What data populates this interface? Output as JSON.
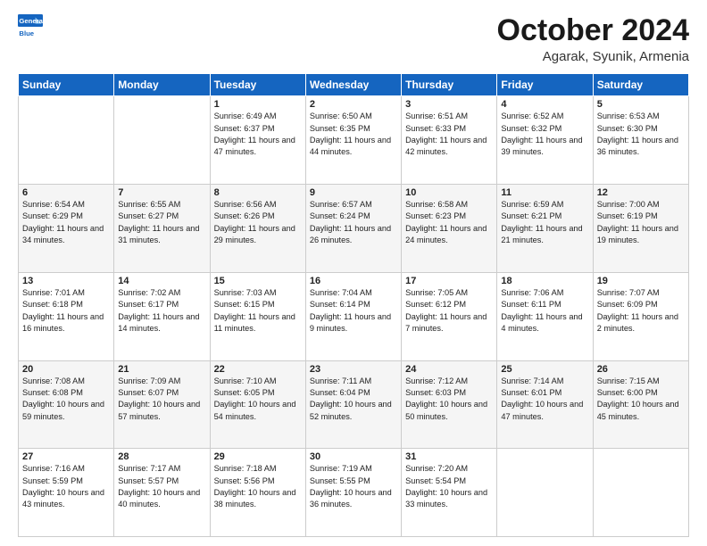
{
  "header": {
    "logo_line1": "General",
    "logo_line2": "Blue",
    "title": "October 2024",
    "subtitle": "Agarak, Syunik, Armenia"
  },
  "days_of_week": [
    "Sunday",
    "Monday",
    "Tuesday",
    "Wednesday",
    "Thursday",
    "Friday",
    "Saturday"
  ],
  "weeks": [
    [
      {
        "day": "",
        "info": ""
      },
      {
        "day": "",
        "info": ""
      },
      {
        "day": "1",
        "info": "Sunrise: 6:49 AM\nSunset: 6:37 PM\nDaylight: 11 hours and 47 minutes."
      },
      {
        "day": "2",
        "info": "Sunrise: 6:50 AM\nSunset: 6:35 PM\nDaylight: 11 hours and 44 minutes."
      },
      {
        "day": "3",
        "info": "Sunrise: 6:51 AM\nSunset: 6:33 PM\nDaylight: 11 hours and 42 minutes."
      },
      {
        "day": "4",
        "info": "Sunrise: 6:52 AM\nSunset: 6:32 PM\nDaylight: 11 hours and 39 minutes."
      },
      {
        "day": "5",
        "info": "Sunrise: 6:53 AM\nSunset: 6:30 PM\nDaylight: 11 hours and 36 minutes."
      }
    ],
    [
      {
        "day": "6",
        "info": "Sunrise: 6:54 AM\nSunset: 6:29 PM\nDaylight: 11 hours and 34 minutes."
      },
      {
        "day": "7",
        "info": "Sunrise: 6:55 AM\nSunset: 6:27 PM\nDaylight: 11 hours and 31 minutes."
      },
      {
        "day": "8",
        "info": "Sunrise: 6:56 AM\nSunset: 6:26 PM\nDaylight: 11 hours and 29 minutes."
      },
      {
        "day": "9",
        "info": "Sunrise: 6:57 AM\nSunset: 6:24 PM\nDaylight: 11 hours and 26 minutes."
      },
      {
        "day": "10",
        "info": "Sunrise: 6:58 AM\nSunset: 6:23 PM\nDaylight: 11 hours and 24 minutes."
      },
      {
        "day": "11",
        "info": "Sunrise: 6:59 AM\nSunset: 6:21 PM\nDaylight: 11 hours and 21 minutes."
      },
      {
        "day": "12",
        "info": "Sunrise: 7:00 AM\nSunset: 6:19 PM\nDaylight: 11 hours and 19 minutes."
      }
    ],
    [
      {
        "day": "13",
        "info": "Sunrise: 7:01 AM\nSunset: 6:18 PM\nDaylight: 11 hours and 16 minutes."
      },
      {
        "day": "14",
        "info": "Sunrise: 7:02 AM\nSunset: 6:17 PM\nDaylight: 11 hours and 14 minutes."
      },
      {
        "day": "15",
        "info": "Sunrise: 7:03 AM\nSunset: 6:15 PM\nDaylight: 11 hours and 11 minutes."
      },
      {
        "day": "16",
        "info": "Sunrise: 7:04 AM\nSunset: 6:14 PM\nDaylight: 11 hours and 9 minutes."
      },
      {
        "day": "17",
        "info": "Sunrise: 7:05 AM\nSunset: 6:12 PM\nDaylight: 11 hours and 7 minutes."
      },
      {
        "day": "18",
        "info": "Sunrise: 7:06 AM\nSunset: 6:11 PM\nDaylight: 11 hours and 4 minutes."
      },
      {
        "day": "19",
        "info": "Sunrise: 7:07 AM\nSunset: 6:09 PM\nDaylight: 11 hours and 2 minutes."
      }
    ],
    [
      {
        "day": "20",
        "info": "Sunrise: 7:08 AM\nSunset: 6:08 PM\nDaylight: 10 hours and 59 minutes."
      },
      {
        "day": "21",
        "info": "Sunrise: 7:09 AM\nSunset: 6:07 PM\nDaylight: 10 hours and 57 minutes."
      },
      {
        "day": "22",
        "info": "Sunrise: 7:10 AM\nSunset: 6:05 PM\nDaylight: 10 hours and 54 minutes."
      },
      {
        "day": "23",
        "info": "Sunrise: 7:11 AM\nSunset: 6:04 PM\nDaylight: 10 hours and 52 minutes."
      },
      {
        "day": "24",
        "info": "Sunrise: 7:12 AM\nSunset: 6:03 PM\nDaylight: 10 hours and 50 minutes."
      },
      {
        "day": "25",
        "info": "Sunrise: 7:14 AM\nSunset: 6:01 PM\nDaylight: 10 hours and 47 minutes."
      },
      {
        "day": "26",
        "info": "Sunrise: 7:15 AM\nSunset: 6:00 PM\nDaylight: 10 hours and 45 minutes."
      }
    ],
    [
      {
        "day": "27",
        "info": "Sunrise: 7:16 AM\nSunset: 5:59 PM\nDaylight: 10 hours and 43 minutes."
      },
      {
        "day": "28",
        "info": "Sunrise: 7:17 AM\nSunset: 5:57 PM\nDaylight: 10 hours and 40 minutes."
      },
      {
        "day": "29",
        "info": "Sunrise: 7:18 AM\nSunset: 5:56 PM\nDaylight: 10 hours and 38 minutes."
      },
      {
        "day": "30",
        "info": "Sunrise: 7:19 AM\nSunset: 5:55 PM\nDaylight: 10 hours and 36 minutes."
      },
      {
        "day": "31",
        "info": "Sunrise: 7:20 AM\nSunset: 5:54 PM\nDaylight: 10 hours and 33 minutes."
      },
      {
        "day": "",
        "info": ""
      },
      {
        "day": "",
        "info": ""
      }
    ]
  ]
}
